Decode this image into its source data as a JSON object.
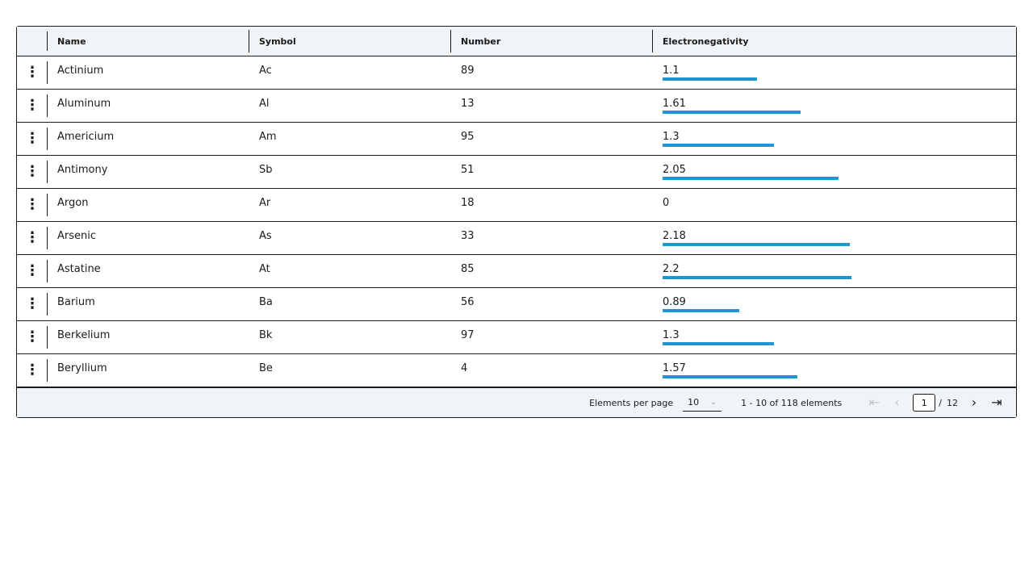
{
  "columns": [
    "Name",
    "Symbol",
    "Number",
    "Electronegativity"
  ],
  "rows": [
    {
      "name": "Actinium",
      "symbol": "Ac",
      "number": "89",
      "en": "1.1",
      "en_value": 1.1
    },
    {
      "name": "Aluminum",
      "symbol": "Al",
      "number": "13",
      "en": "1.61",
      "en_value": 1.61
    },
    {
      "name": "Americium",
      "symbol": "Am",
      "number": "95",
      "en": "1.3",
      "en_value": 1.3
    },
    {
      "name": "Antimony",
      "symbol": "Sb",
      "number": "51",
      "en": "2.05",
      "en_value": 2.05
    },
    {
      "name": "Argon",
      "symbol": "Ar",
      "number": "18",
      "en": "0",
      "en_value": 0
    },
    {
      "name": "Arsenic",
      "symbol": "As",
      "number": "33",
      "en": "2.18",
      "en_value": 2.18
    },
    {
      "name": "Astatine",
      "symbol": "At",
      "number": "85",
      "en": "2.2",
      "en_value": 2.2
    },
    {
      "name": "Barium",
      "symbol": "Ba",
      "number": "56",
      "en": "0.89",
      "en_value": 0.89
    },
    {
      "name": "Berkelium",
      "symbol": "Bk",
      "number": "97",
      "en": "1.3",
      "en_value": 1.3
    },
    {
      "name": "Beryllium",
      "symbol": "Be",
      "number": "4",
      "en": "1.57",
      "en_value": 1.57
    }
  ],
  "electronegativity_max": 4,
  "row_menu_icon": "more-vertical-icon",
  "bar_color": "#1e96d2",
  "footer": {
    "per_page_label": "Elements per page",
    "per_page_value": "10",
    "range_text": "1 - 10 of 118 elements",
    "current_page": "1",
    "slash": "/",
    "total_pages": "12"
  }
}
